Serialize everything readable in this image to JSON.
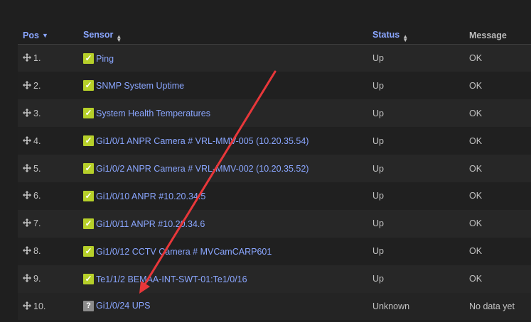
{
  "header": {
    "pos": "Pos",
    "sensor": "Sensor",
    "status": "Status",
    "message": "Message"
  },
  "rows": [
    {
      "pos": "1.",
      "sensor": "Ping",
      "status": "Up",
      "message": "OK",
      "state": "up"
    },
    {
      "pos": "2.",
      "sensor": "SNMP System Uptime",
      "status": "Up",
      "message": "OK",
      "state": "up"
    },
    {
      "pos": "3.",
      "sensor": "System Health Temperatures",
      "status": "Up",
      "message": "OK",
      "state": "up"
    },
    {
      "pos": "4.",
      "sensor": "Gi1/0/1 ANPR Camera # VRL-MMV-005 (10.20.35.54)",
      "status": "Up",
      "message": "OK",
      "state": "up"
    },
    {
      "pos": "5.",
      "sensor": "Gi1/0/2 ANPR Camera # VRL-MMV-002 (10.20.35.52)",
      "status": "Up",
      "message": "OK",
      "state": "up"
    },
    {
      "pos": "6.",
      "sensor": "Gi1/0/10 ANPR #10.20.34.5",
      "status": "Up",
      "message": "OK",
      "state": "up"
    },
    {
      "pos": "7.",
      "sensor": "Gi1/0/11 ANPR #10.20.34.6",
      "status": "Up",
      "message": "OK",
      "state": "up"
    },
    {
      "pos": "8.",
      "sensor": "Gi1/0/12 CCTV Camera # MVCamCARP601",
      "status": "Up",
      "message": "OK",
      "state": "up"
    },
    {
      "pos": "9.",
      "sensor": "Te1/1/2 BEMAA-INT-SWT-01:Te1/0/16",
      "status": "Up",
      "message": "OK",
      "state": "up"
    },
    {
      "pos": "10.",
      "sensor": "Gi1/0/24 UPS",
      "status": "Unknown",
      "message": "No data yet",
      "state": "unknown"
    }
  ],
  "icons": {
    "row_handle": "move-icon",
    "status_up": "check-icon",
    "status_unknown": "question-icon",
    "sort": "sort-icon"
  },
  "colors": {
    "link": "#8aa6ff",
    "status_up": "#b7d02a",
    "status_unknown": "#8c8c8c",
    "annotation_arrow": "#e8373a"
  }
}
